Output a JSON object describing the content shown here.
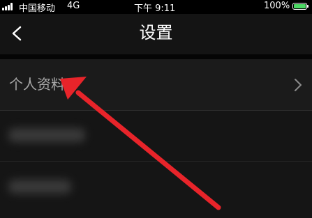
{
  "status_bar": {
    "carrier": "中国移动",
    "network": "4G",
    "time": "下午 9:11",
    "battery_percent": "100%",
    "battery_level": 1.0,
    "battery_color": "#4cd964"
  },
  "header": {
    "back_icon": "chevron-left-icon",
    "title": "设置"
  },
  "settings": {
    "items": [
      {
        "label": "个人资料",
        "icon": "chevron-right-icon"
      }
    ]
  },
  "annotation": {
    "arrow_color": "#e8242a"
  }
}
